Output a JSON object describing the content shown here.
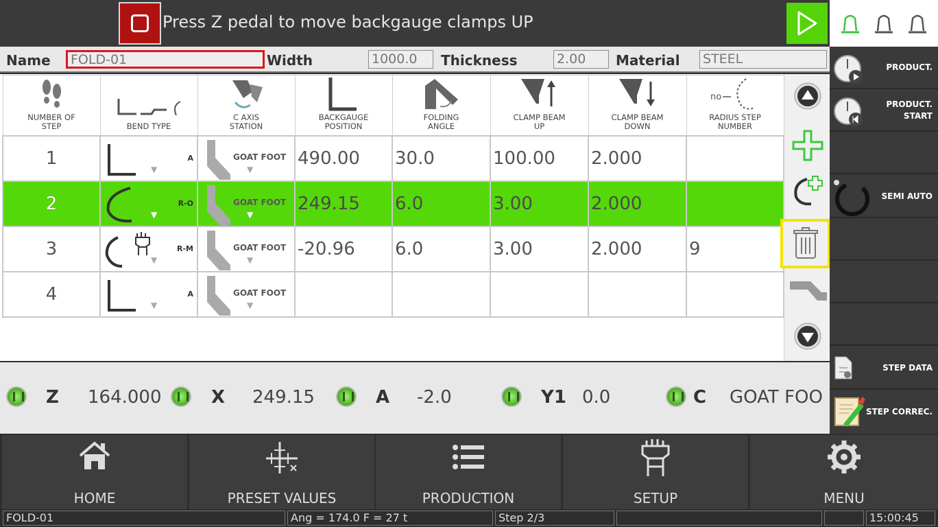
{
  "message": "Press Z pedal to move backgauge clamps UP",
  "header": {
    "name_label": "Name",
    "name_value": "FOLD-01",
    "width_label": "Width",
    "width_value": "1000.0",
    "thickness_label": "Thickness",
    "thickness_value": "2.00",
    "material_label": "Material",
    "material_value": "STEEL"
  },
  "columns": [
    {
      "l1": "NUMBER OF",
      "l2": "STEP",
      "icon": "footprints-icon"
    },
    {
      "l1": "BEND TYPE",
      "l2": "",
      "icon": "bend-type-icon"
    },
    {
      "l1": "C AXIS",
      "l2": "STATION",
      "icon": "c-axis-station-icon"
    },
    {
      "l1": "BACKGAUGE",
      "l2": "POSITION",
      "icon": "backgauge-icon"
    },
    {
      "l1": "FOLDING",
      "l2": "ANGLE",
      "icon": "folding-angle-icon"
    },
    {
      "l1": "CLAMP BEAM",
      "l2": "UP",
      "icon": "clamp-beam-up-icon"
    },
    {
      "l1": "CLAMP BEAM",
      "l2": "DOWN",
      "icon": "clamp-beam-down-icon"
    },
    {
      "l1": "RADIUS STEP",
      "l2": "NUMBER",
      "icon": "radius-step-icon",
      "icon_text": "no"
    }
  ],
  "rows": [
    {
      "step": "1",
      "bend_code": "A",
      "bend_icon": "angle-bend-icon",
      "station": "GOAT FOOT",
      "backgauge": "490.00",
      "angle": "30.0",
      "clamp_up": "100.00",
      "clamp_down": "2.000",
      "radius_step": ""
    },
    {
      "step": "2",
      "bend_code": "R-O",
      "bend_icon": "radius-bend-icon",
      "station": "GOAT FOOT",
      "backgauge": "249.15",
      "angle": "6.0",
      "clamp_up": "3.00",
      "clamp_down": "2.000",
      "radius_step": "",
      "selected": true
    },
    {
      "step": "3",
      "bend_code": "R-M",
      "bend_icon": "radius-manual-bend-icon",
      "station": "GOAT FOOT",
      "backgauge": "-20.96",
      "angle": "6.0",
      "clamp_up": "3.00",
      "clamp_down": "2.000",
      "radius_step": "9"
    },
    {
      "step": "4",
      "bend_code": "A",
      "bend_icon": "angle-bend-icon",
      "station": "GOAT FOOT",
      "backgauge": "",
      "angle": "",
      "clamp_up": "",
      "clamp_down": "",
      "radius_step": ""
    }
  ],
  "axes": [
    {
      "name": "Z",
      "value": "164.000"
    },
    {
      "name": "X",
      "value": "249.15"
    },
    {
      "name": "A",
      "value": "-2.0"
    },
    {
      "name": "Y1",
      "value": "0.0"
    },
    {
      "name": "C",
      "value": "GOAT FOO"
    }
  ],
  "sidebar": {
    "production": "PRODUCT.",
    "production_start_1": "PRODUCT.",
    "production_start_2": "START",
    "semi_auto": "SEMI AUTO",
    "step_data": "STEP DATA",
    "step_correc": "STEP CORREC."
  },
  "nav": {
    "home": "HOME",
    "preset": "PRESET VALUES",
    "production": "PRODUCTION",
    "setup": "SETUP",
    "menu": "MENU"
  },
  "status": {
    "program": "FOLD-01",
    "ang_force": "Ang = 174.0  F = 27 t",
    "step": "Step 2/3",
    "time": "15:00:45"
  },
  "colors": {
    "selected_row": "#55d80a",
    "start_button": "#55d40a",
    "stop_button": "#b01212",
    "highlight_border": "#f4e400"
  }
}
